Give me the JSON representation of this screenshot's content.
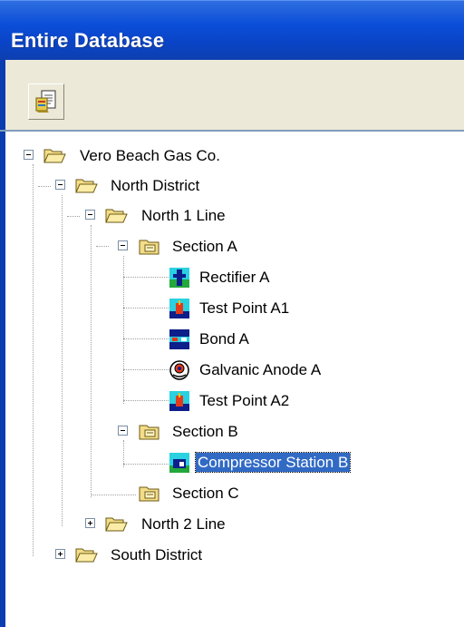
{
  "window": {
    "title": "Entire Database"
  },
  "toolbar": {
    "buttons": [
      {
        "icon": "document-report-icon"
      }
    ]
  },
  "tree": {
    "nodes": [
      {
        "label": "Vero Beach Gas Co.",
        "icon": "folder-open-icon",
        "expander": "minus"
      },
      {
        "label": "North District",
        "icon": "folder-open-icon",
        "expander": "minus"
      },
      {
        "label": "North 1 Line",
        "icon": "folder-open-icon",
        "expander": "minus"
      },
      {
        "label": "Section A",
        "icon": "section-folder-icon",
        "expander": "minus"
      },
      {
        "label": "Rectifier A",
        "icon": "rectifier-icon"
      },
      {
        "label": "Test Point A1",
        "icon": "test-point-icon"
      },
      {
        "label": "Bond A",
        "icon": "bond-icon"
      },
      {
        "label": "Galvanic Anode A",
        "icon": "galvanic-anode-icon"
      },
      {
        "label": "Test Point A2",
        "icon": "test-point-icon"
      },
      {
        "label": "Section B",
        "icon": "section-folder-icon",
        "expander": "minus"
      },
      {
        "label": "Compressor Station B",
        "icon": "compressor-station-icon",
        "selected": true
      },
      {
        "label": "Section C",
        "icon": "section-folder-icon"
      },
      {
        "label": "North 2 Line",
        "icon": "folder-open-icon",
        "expander": "plus"
      },
      {
        "label": "South District",
        "icon": "folder-open-icon",
        "expander": "plus"
      }
    ]
  },
  "colors": {
    "titlebar": "#0a4ed8",
    "selection": "#316ac5",
    "toolbar": "#ece9d8"
  }
}
